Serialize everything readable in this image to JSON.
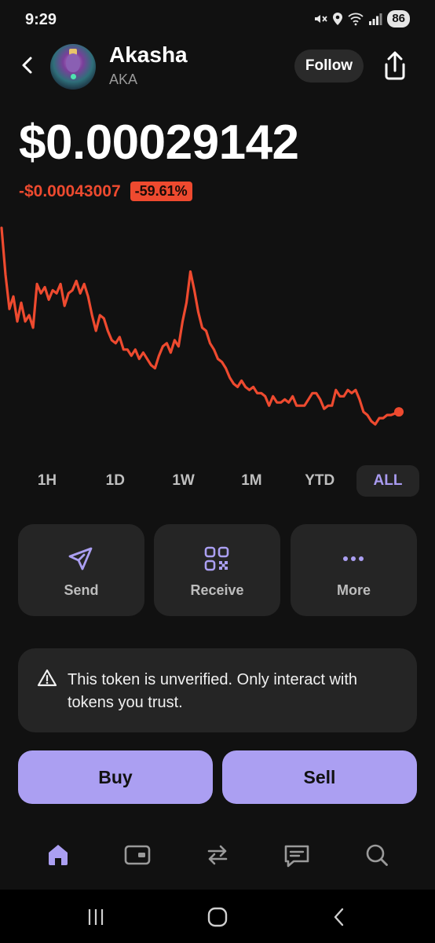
{
  "status_bar": {
    "time": "9:29",
    "battery": "86"
  },
  "header": {
    "token_name": "Akasha",
    "token_symbol": "AKA",
    "follow_label": "Follow",
    "icons": {
      "back": "chevron-left-icon",
      "share": "share-icon"
    }
  },
  "price": {
    "current": "$0.00029142",
    "change_abs": "-$0.00043007",
    "change_pct": "-59.61%",
    "negative_color": "#ee4a2f"
  },
  "chart_data": {
    "type": "line",
    "color": "#ee4a2f",
    "values": [
      100,
      85,
      74,
      78,
      70,
      76,
      70,
      72,
      68,
      82,
      79,
      81,
      77,
      80,
      79,
      82,
      75,
      79,
      80,
      83,
      79,
      82,
      78,
      72,
      67,
      72,
      71,
      67,
      64,
      63,
      65,
      61,
      61,
      59,
      61,
      58,
      60,
      58,
      56,
      55,
      59,
      62,
      63,
      60,
      64,
      62,
      70,
      76,
      86,
      80,
      73,
      68,
      67,
      63,
      61,
      58,
      57,
      55,
      52,
      50,
      49,
      51,
      49,
      48,
      49,
      47,
      47,
      46,
      43,
      46,
      44,
      44,
      45,
      44,
      46,
      43,
      43,
      43,
      45,
      47,
      47,
      45,
      42,
      43,
      43,
      48,
      46,
      46,
      48,
      47,
      48,
      45,
      41,
      40,
      38,
      37,
      39,
      39,
      40,
      40,
      40.5,
      41
    ],
    "timeframes": [
      "1H",
      "1D",
      "1W",
      "1M",
      "YTD",
      "ALL"
    ],
    "selected_timeframe": "ALL"
  },
  "actions": [
    {
      "label": "Send",
      "icon": "send-icon"
    },
    {
      "label": "Receive",
      "icon": "qr-code-icon"
    },
    {
      "label": "More",
      "icon": "more-dots-icon"
    }
  ],
  "warning": {
    "icon": "warning-triangle-icon",
    "text": "This token is unverified. Only interact with tokens you trust."
  },
  "trade": {
    "buy_label": "Buy",
    "sell_label": "Sell",
    "accent": "#ab9ff2"
  },
  "tabs": [
    {
      "icon": "home-icon",
      "active": true
    },
    {
      "icon": "wallet-icon"
    },
    {
      "icon": "swap-icon"
    },
    {
      "icon": "messages-icon"
    },
    {
      "icon": "search-icon"
    }
  ]
}
